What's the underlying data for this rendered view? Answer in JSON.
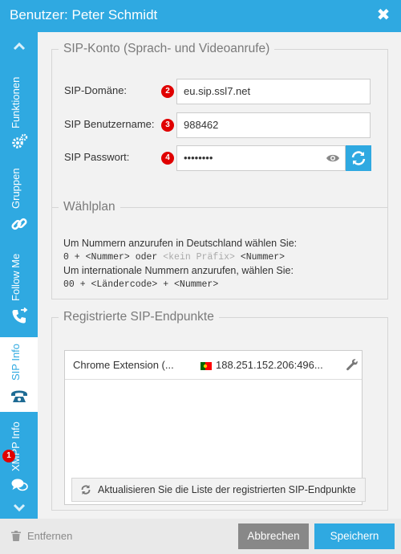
{
  "window": {
    "title": "Benutzer: Peter Schmidt",
    "close_glyph": "✖"
  },
  "sidebar": {
    "tabs": [
      {
        "label": "Funktionen",
        "icon": "gears-icon"
      },
      {
        "label": "Gruppen",
        "icon": "link-icon"
      },
      {
        "label": "Follow Me",
        "icon": "phone-forward-icon"
      },
      {
        "label": "SIP Info",
        "icon": "telephone-icon",
        "active": true
      },
      {
        "label": "XMPP Info",
        "icon": "chat-bubbles-icon",
        "badge": "1"
      }
    ]
  },
  "sip_account": {
    "legend": "SIP-Konto (Sprach- und Videoanrufe)",
    "fields": [
      {
        "label": "SIP-Domäne:",
        "badge": "2",
        "value": "eu.sip.ssl7.net"
      },
      {
        "label": "SIP Benutzername:",
        "badge": "3",
        "value": "988462"
      },
      {
        "label": "SIP Passwort:",
        "badge": "4",
        "value": "••••••••"
      }
    ]
  },
  "dialplan": {
    "legend": "Wählplan",
    "line1": "Um Nummern anzurufen in Deutschland wählen Sie:",
    "line2_a": "0 + <Nummer> oder ",
    "line2_b": "<kein Präfix>",
    "line2_c": " <Nummer>",
    "line3": "Um internationale Nummern anzurufen, wählen Sie:",
    "line4": "00 + <Ländercode> + <Nummer>"
  },
  "endpoints": {
    "legend": "Registrierte SIP-Endpunkte",
    "items": [
      {
        "name": "Chrome Extension (...",
        "flag": "portugal-flag-icon",
        "ip": "188.251.152.206:496..."
      }
    ],
    "refresh_label": "Aktualisieren Sie die Liste der registrierten SIP-Endpunkte"
  },
  "footer": {
    "remove_label": "Entfernen",
    "cancel_label": "Abbrechen",
    "save_label": "Speichern"
  },
  "colors": {
    "accent": "#2fa9e1",
    "badge": "#e00000",
    "cancel": "#888888"
  }
}
